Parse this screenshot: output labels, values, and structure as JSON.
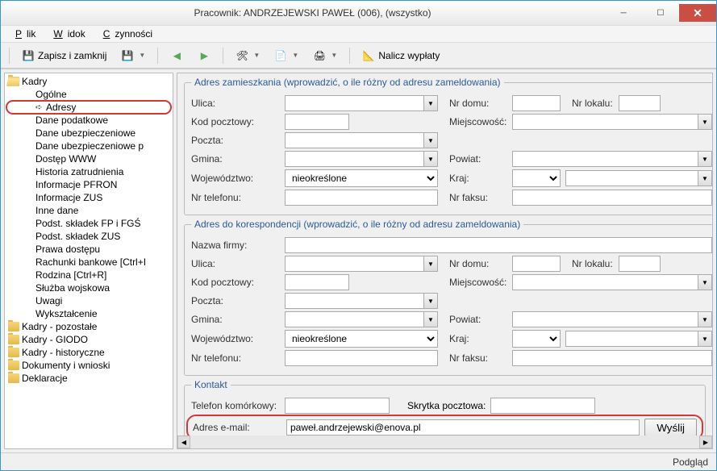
{
  "window": {
    "title": "Pracownik: ANDRZEJEWSKI PAWEŁ (006), (wszystko)"
  },
  "menu": {
    "plik": "Plik",
    "widok": "Widok",
    "czynnosci": "Czynności"
  },
  "toolbar": {
    "save_close": "Zapisz i zamknij",
    "nalicz": "Nalicz wypłaty"
  },
  "tree": {
    "root": "Kadry",
    "items": [
      "Ogólne",
      "Adresy",
      "Dane podatkowe",
      "Dane ubezpieczeniowe",
      "Dane ubezpieczeniowe p",
      "Dostęp WWW",
      "Historia zatrudnienia",
      "Informacje PFRON",
      "Informacje ZUS",
      "Inne dane",
      "Podst. składek FP i FGŚ",
      "Podst. składek ZUS",
      "Prawa dostępu",
      "Rachunki bankowe [Ctrl+I",
      "Rodzina [Ctrl+R]",
      "Służba wojskowa",
      "Uwagi",
      "Wykształcenie"
    ],
    "folders": [
      "Kadry - pozostałe",
      "Kadry - GIODO",
      "Kadry - historyczne",
      "Dokumenty i wnioski",
      "Deklaracje"
    ]
  },
  "form": {
    "section1": "Adres zamieszkania (wprowadzić, o ile różny od adresu zameldowania)",
    "section2": "Adres do korespondencji (wprowadzić, o ile różny od adresu zameldowania)",
    "section3": "Kontakt",
    "labels": {
      "ulica": "Ulica:",
      "nr_domu": "Nr domu:",
      "nr_lokalu": "Nr lokalu:",
      "kod": "Kod pocztowy:",
      "miejscowosc": "Miejscowość:",
      "poczta": "Poczta:",
      "gmina": "Gmina:",
      "powiat": "Powiat:",
      "woj": "Województwo:",
      "kraj": "Kraj:",
      "nr_tel": "Nr telefonu:",
      "nr_faksu": "Nr faksu:",
      "nazwa_firmy": "Nazwa firmy:",
      "tel_kom": "Telefon komórkowy:",
      "skrytka": "Skrytka pocztowa:",
      "email": "Adres e-mail:",
      "wyslij": "Wyślij"
    },
    "values": {
      "woj1": "nieokreślone",
      "woj2": "nieokreślone",
      "email": "paweł.andrzejewski@enova.pl"
    }
  },
  "statusbar": {
    "text": "Podgląd"
  }
}
